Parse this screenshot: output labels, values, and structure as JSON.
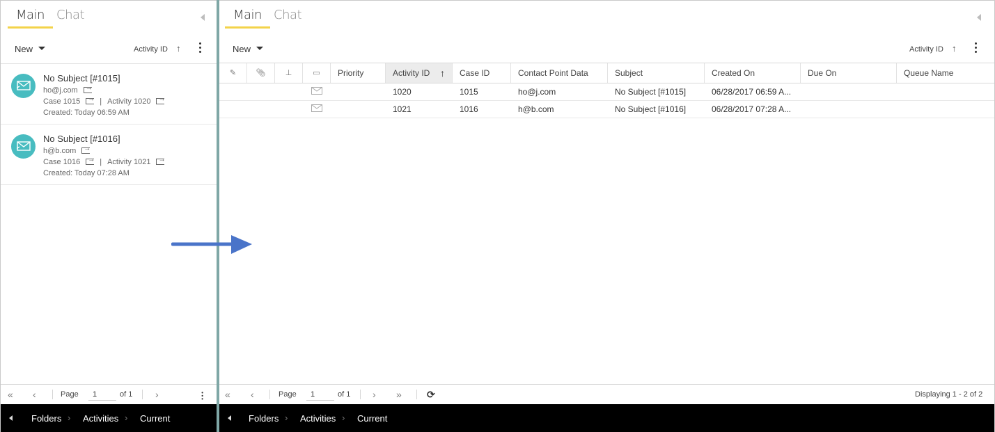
{
  "left": {
    "tabs": [
      {
        "label": "Main"
      },
      {
        "label": "Chat"
      }
    ],
    "toolbar": {
      "new_label": "New",
      "sort_label": "Activity ID",
      "sort_arrow": "↑"
    },
    "items": [
      {
        "subject": "No Subject [#1015]",
        "email": "ho@j.com",
        "case": "Case 1015",
        "activity": "Activity 1020",
        "created": "Created: Today 06:59 AM"
      },
      {
        "subject": "No Subject [#1016]",
        "email": "h@b.com",
        "case": "Case 1016",
        "activity": "Activity 1021",
        "created": "Created: Today 07:28 AM"
      }
    ],
    "pager": {
      "page_label": "Page",
      "page_value": "1",
      "of_label": "of 1"
    },
    "breadcrumbs": [
      "Folders",
      "Activities",
      "Current"
    ]
  },
  "right": {
    "tabs": [
      {
        "label": "Main"
      },
      {
        "label": "Chat"
      }
    ],
    "toolbar": {
      "new_label": "New",
      "sort_label": "Activity ID",
      "sort_arrow": "↑"
    },
    "columns": [
      "Priority",
      "Activity ID",
      "Case ID",
      "Contact Point Data",
      "Subject",
      "Created On",
      "Due On",
      "Queue Name"
    ],
    "sort_indicator": "🠕",
    "rows": [
      {
        "priority": "",
        "activity_id": "1020",
        "case_id": "1015",
        "contact": "ho@j.com",
        "subject": "No Subject [#1015]",
        "created_on": "06/28/2017 06:59 A...",
        "due_on": "",
        "queue": ""
      },
      {
        "priority": "",
        "activity_id": "1021",
        "case_id": "1016",
        "contact": "h@b.com",
        "subject": "No Subject [#1016]",
        "created_on": "06/28/2017 07:28 A...",
        "due_on": "",
        "queue": ""
      }
    ],
    "pager": {
      "page_label": "Page",
      "page_value": "1",
      "of_label": "of 1",
      "displaying": "Displaying 1 - 2 of 2"
    },
    "breadcrumbs": [
      "Folders",
      "Activities",
      "Current"
    ]
  },
  "icons": {
    "collapse": "triangle-left-icon",
    "email": "envelope-icon",
    "external": "external-link-icon",
    "annotation_arrow": "right-arrow-icon"
  },
  "colors": {
    "accent_tab": "#f3d34a",
    "avatar": "#48bcc0",
    "divider": "#7fa7a6",
    "arrow": "#4a74c9",
    "breadcrumb_bar": "#000000"
  }
}
